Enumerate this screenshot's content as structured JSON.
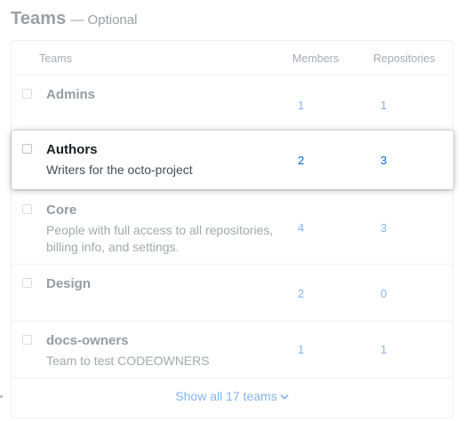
{
  "section": {
    "title": "Teams",
    "optional": "— Optional"
  },
  "table": {
    "columns": {
      "teams": "Teams",
      "members": "Members",
      "repositories": "Repositories"
    },
    "rows": [
      {
        "name": "Admins",
        "description": "",
        "members": "1",
        "repositories": "1"
      },
      {
        "name": "Authors",
        "description": "Writers for the octo-project",
        "members": "2",
        "repositories": "3"
      },
      {
        "name": "Core",
        "description": "People with full access to all repositories, billing info, and settings.",
        "members": "4",
        "repositories": "3"
      },
      {
        "name": "Design",
        "description": "",
        "members": "2",
        "repositories": "0"
      },
      {
        "name": "docs-owners",
        "description": "Team to test CODEOWNERS",
        "members": "1",
        "repositories": "1"
      }
    ]
  },
  "footer": {
    "show_all_label": "Show all 17 teams",
    "icon": "chevron-down-icon"
  },
  "colors": {
    "link": "#0366d6",
    "link_faded": "#85b5ea",
    "border": "#eef0f2"
  }
}
